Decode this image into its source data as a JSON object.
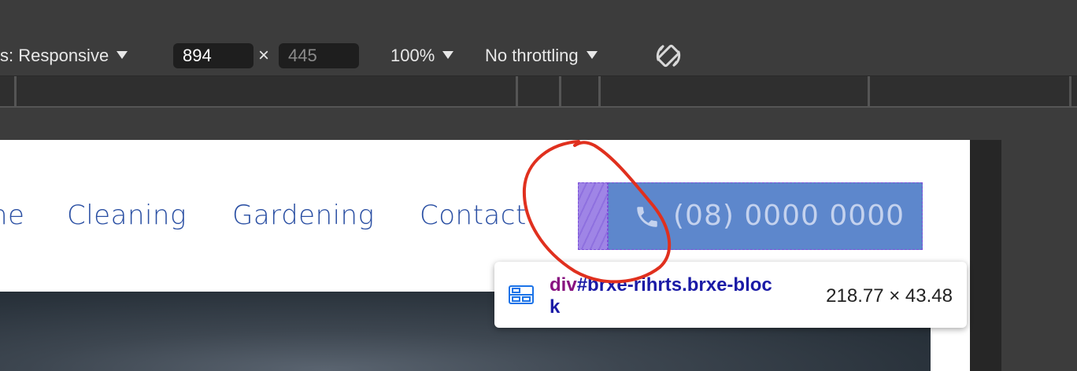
{
  "toolbar": {
    "device_label": "s: Responsive",
    "width_value": "894",
    "height_placeholder": "445",
    "times": "×",
    "zoom_label": "100%",
    "throttle_label": "No throttling",
    "rotate_icon": "rotate-icon"
  },
  "nav": {
    "items": [
      {
        "label": "ne"
      },
      {
        "label": "Cleaning"
      },
      {
        "label": "Gardening"
      },
      {
        "label": "Contact"
      }
    ]
  },
  "phone_button": {
    "icon": "phone-icon",
    "label": "(08) 0000 0000"
  },
  "inspector_tooltip": {
    "icon": "flex-layout-icon",
    "tag": "div",
    "selector": "#brxe-rihrts.brxe-block",
    "size": "218.77 × 43.48"
  },
  "colors": {
    "nav_text": "#2a4fa3",
    "phone_bg": "#5d87cc",
    "padding_highlight": "#9f85e6",
    "annotation": "#e0301e"
  }
}
